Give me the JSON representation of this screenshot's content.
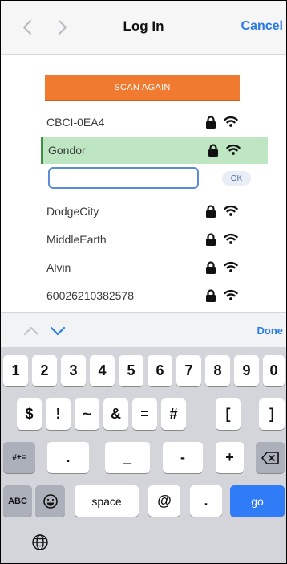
{
  "nav": {
    "title": "Log In",
    "cancel_label": "Cancel",
    "back_icon": "chevron-left-icon",
    "forward_icon": "chevron-right-icon"
  },
  "scan_button_label": "SCAN AGAIN",
  "networks": [
    {
      "ssid": "CBCI-0EA4"
    },
    {
      "ssid": "Gondor",
      "selected": true
    },
    {
      "ssid": "DodgeCity"
    },
    {
      "ssid": "MiddleEarth"
    },
    {
      "ssid": "Alvin"
    },
    {
      "ssid": "60026210382578"
    }
  ],
  "password_input": {
    "value": "",
    "placeholder": ""
  },
  "ok_label": "OK",
  "accessory": {
    "done_label": "Done"
  },
  "keyboard": {
    "row1": [
      "1",
      "2",
      "3",
      "4",
      "5",
      "6",
      "7",
      "8",
      "9",
      "0"
    ],
    "row2": [
      "$",
      "!",
      "~",
      "&",
      "=",
      "#",
      "[",
      "]"
    ],
    "row3": [
      ".",
      "_",
      "-",
      "+"
    ],
    "shift_label": "#+=",
    "abc_label": "ABC",
    "space_label": "space",
    "at_label": "@",
    "dot_label": ".",
    "go_label": "go"
  },
  "colors": {
    "accent": "#2d7be5",
    "scan_button": "#f07b30",
    "selected_row": "#bfe6c3",
    "go_key": "#2f7cf6"
  }
}
